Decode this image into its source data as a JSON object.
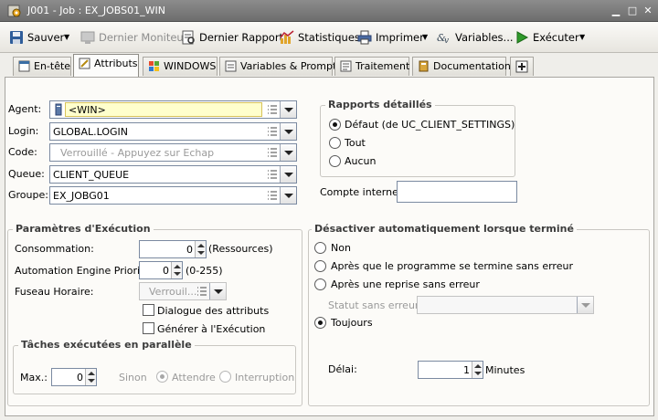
{
  "window": {
    "title": "J001 - Job : EX_JOBS01_WIN"
  },
  "toolbar": {
    "save": "Sauver",
    "last_monitor": "Dernier Moniteur",
    "last_report": "Dernier Rapport",
    "statistics": "Statistiques",
    "print": "Imprimer",
    "variables": "Variables...",
    "execute": "Exécuter"
  },
  "tabs": [
    {
      "label": "En-tête"
    },
    {
      "label": "Attributs"
    },
    {
      "label": "WINDOWS"
    },
    {
      "label": "Variables & Prompts"
    },
    {
      "label": "Traitement"
    },
    {
      "label": "Documentation"
    }
  ],
  "attributes": {
    "agent_label": "Agent:",
    "agent_value": "<WIN>",
    "login_label": "Login:",
    "login_value": "GLOBAL.LOGIN",
    "code_label": "Code:",
    "code_value": "Verrouillé - Appuyez sur Echap",
    "queue_label": "Queue:",
    "queue_value": "CLIENT_QUEUE",
    "group_label": "Groupe:",
    "group_value": "EX_JOBG01"
  },
  "reports": {
    "title": "Rapports détaillés",
    "options": [
      "Défaut (de UC_CLIENT_SETTINGS)",
      "Tout",
      "Aucun"
    ],
    "selected": "Défaut (de UC_CLIENT_SETTINGS)"
  },
  "internal_account": {
    "label": "Compte interne:",
    "value": ""
  },
  "execution": {
    "title": "Paramètres d'Exécution",
    "consumption_label": "Consommation:",
    "consumption_value": "0",
    "consumption_unit": "(Ressources)",
    "priority_label": "Automation Engine Priorité:",
    "priority_value": "0",
    "priority_range": "(0-255)",
    "timezone_label": "Fuseau Horaire:",
    "timezone_value": "Verrouil...",
    "attr_dialog_label": "Dialogue des attributs",
    "attr_dialog_checked": false,
    "generate_label": "Générer à l'Exécution",
    "generate_checked": false
  },
  "parallel": {
    "title": "Tâches exécutées en parallèle",
    "max_label": "Max.:",
    "max_value": "0",
    "else_label": "Sinon",
    "options": [
      "Attendre",
      "Interruption"
    ],
    "selected": "Attendre"
  },
  "deactivate": {
    "title": "Désactiver automatiquement lorsque terminé",
    "options": [
      "Non",
      "Après que le programme se termine sans erreur",
      "Après une reprise sans erreur",
      "Toujours"
    ],
    "selected": "Toujours",
    "status_label": "Statut sans erreur:",
    "status_value": "",
    "delay_label": "Délai:",
    "delay_value": "1",
    "delay_unit": "Minutes"
  },
  "colors": {
    "titlebar": "#7a7a7a",
    "panel": "#fcfbf8",
    "accent": "#ffffcc"
  }
}
